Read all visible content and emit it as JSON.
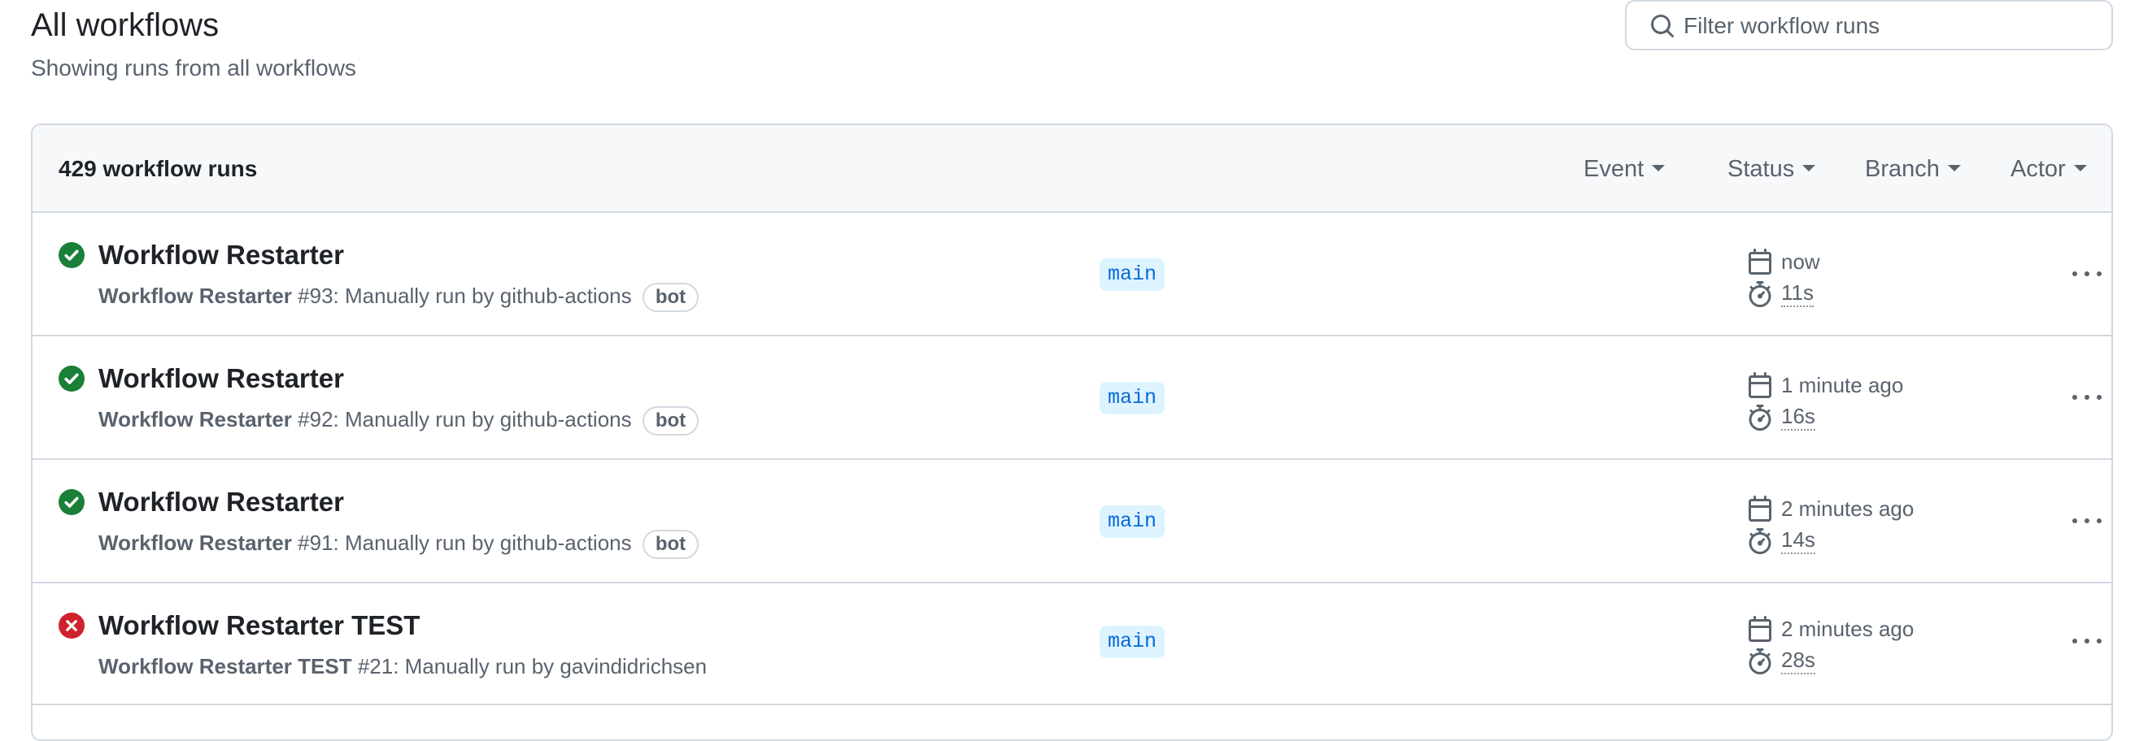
{
  "page": {
    "title": "All workflows",
    "subtitle": "Showing runs from all workflows",
    "filter_placeholder": "Filter workflow runs"
  },
  "runs_header": {
    "count_label": "429 workflow runs",
    "filters": [
      "Event",
      "Status",
      "Branch",
      "Actor"
    ]
  },
  "colors": {
    "success": "#1a7f37",
    "failure": "#cf222e",
    "branch_bg": "#ddf4ff",
    "branch_text": "#0969da"
  },
  "runs": [
    {
      "status": "success",
      "status_icon": "check-circle-icon",
      "title": "Workflow Restarter",
      "workflow_name": "Workflow Restarter",
      "run_detail": " #93: Manually run by github-actions",
      "badge": "bot",
      "branch": "main",
      "started": "now",
      "duration": "11s"
    },
    {
      "status": "success",
      "status_icon": "check-circle-icon",
      "title": "Workflow Restarter",
      "workflow_name": "Workflow Restarter",
      "run_detail": " #92: Manually run by github-actions",
      "badge": "bot",
      "branch": "main",
      "started": "1 minute ago",
      "duration": "16s"
    },
    {
      "status": "success",
      "status_icon": "check-circle-icon",
      "title": "Workflow Restarter",
      "workflow_name": "Workflow Restarter",
      "run_detail": " #91: Manually run by github-actions",
      "badge": "bot",
      "branch": "main",
      "started": "2 minutes ago",
      "duration": "14s"
    },
    {
      "status": "failure",
      "status_icon": "x-circle-icon",
      "title": "Workflow Restarter TEST",
      "workflow_name": "Workflow Restarter TEST",
      "run_detail": " #21: Manually run by gavindidrichsen",
      "badge": "",
      "branch": "main",
      "started": "2 minutes ago",
      "duration": "28s"
    }
  ]
}
